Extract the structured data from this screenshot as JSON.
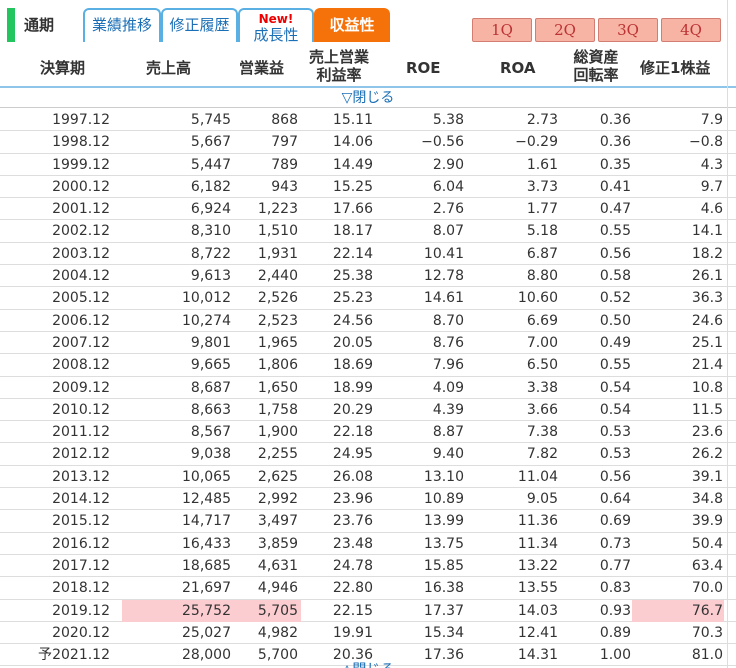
{
  "tabs": {
    "tsuki": "通期",
    "gyoseki": "業績推移",
    "shusei": "修正履歴",
    "seichou_badge": "New!",
    "seichou": "成長性",
    "shueki": "収益性"
  },
  "quarters": [
    "1Q",
    "2Q",
    "3Q",
    "4Q"
  ],
  "headers": {
    "period": "決算期",
    "sales": "売上高",
    "op": "営業益",
    "margin_l1": "売上営業",
    "margin_l2": "利益率",
    "roe": "ROE",
    "roa": "ROA",
    "turnover_l1": "総資産",
    "turnover_l2": "回転率",
    "eps": "修正1株益"
  },
  "toggle": {
    "close_top": "▽閉じる",
    "close_bottom": "△閉じる"
  },
  "colors": {
    "accent": "#f5720a",
    "highlight": "#fbcdd0",
    "tab_border": "#5bb0e3",
    "green_bar": "#22c55e"
  },
  "rows": [
    {
      "year": "1997.12",
      "sales": "5,745",
      "op": "868",
      "margin": "15.11",
      "roe": "5.38",
      "roa": "2.73",
      "turnover": "0.36",
      "eps": "7.9"
    },
    {
      "year": "1998.12",
      "sales": "5,667",
      "op": "797",
      "margin": "14.06",
      "roe": "−0.56",
      "roa": "−0.29",
      "turnover": "0.36",
      "eps": "−0.8"
    },
    {
      "year": "1999.12",
      "sales": "5,447",
      "op": "789",
      "margin": "14.49",
      "roe": "2.90",
      "roa": "1.61",
      "turnover": "0.35",
      "eps": "4.3"
    },
    {
      "year": "2000.12",
      "sales": "6,182",
      "op": "943",
      "margin": "15.25",
      "roe": "6.04",
      "roa": "3.73",
      "turnover": "0.41",
      "eps": "9.7"
    },
    {
      "year": "2001.12",
      "sales": "6,924",
      "op": "1,223",
      "margin": "17.66",
      "roe": "2.76",
      "roa": "1.77",
      "turnover": "0.47",
      "eps": "4.6"
    },
    {
      "year": "2002.12",
      "sales": "8,310",
      "op": "1,510",
      "margin": "18.17",
      "roe": "8.07",
      "roa": "5.18",
      "turnover": "0.55",
      "eps": "14.1"
    },
    {
      "year": "2003.12",
      "sales": "8,722",
      "op": "1,931",
      "margin": "22.14",
      "roe": "10.41",
      "roa": "6.87",
      "turnover": "0.56",
      "eps": "18.2"
    },
    {
      "year": "2004.12",
      "sales": "9,613",
      "op": "2,440",
      "margin": "25.38",
      "roe": "12.78",
      "roa": "8.80",
      "turnover": "0.58",
      "eps": "26.1"
    },
    {
      "year": "2005.12",
      "sales": "10,012",
      "op": "2,526",
      "margin": "25.23",
      "roe": "14.61",
      "roa": "10.60",
      "turnover": "0.52",
      "eps": "36.3"
    },
    {
      "year": "2006.12",
      "sales": "10,274",
      "op": "2,523",
      "margin": "24.56",
      "roe": "8.70",
      "roa": "6.69",
      "turnover": "0.50",
      "eps": "24.6"
    },
    {
      "year": "2007.12",
      "sales": "9,801",
      "op": "1,965",
      "margin": "20.05",
      "roe": "8.76",
      "roa": "7.00",
      "turnover": "0.49",
      "eps": "25.1"
    },
    {
      "year": "2008.12",
      "sales": "9,665",
      "op": "1,806",
      "margin": "18.69",
      "roe": "7.96",
      "roa": "6.50",
      "turnover": "0.55",
      "eps": "21.4"
    },
    {
      "year": "2009.12",
      "sales": "8,687",
      "op": "1,650",
      "margin": "18.99",
      "roe": "4.09",
      "roa": "3.38",
      "turnover": "0.54",
      "eps": "10.8"
    },
    {
      "year": "2010.12",
      "sales": "8,663",
      "op": "1,758",
      "margin": "20.29",
      "roe": "4.39",
      "roa": "3.66",
      "turnover": "0.54",
      "eps": "11.5"
    },
    {
      "year": "2011.12",
      "sales": "8,567",
      "op": "1,900",
      "margin": "22.18",
      "roe": "8.87",
      "roa": "7.38",
      "turnover": "0.53",
      "eps": "23.6"
    },
    {
      "year": "2012.12",
      "sales": "9,038",
      "op": "2,255",
      "margin": "24.95",
      "roe": "9.40",
      "roa": "7.82",
      "turnover": "0.53",
      "eps": "26.2"
    },
    {
      "year": "2013.12",
      "sales": "10,065",
      "op": "2,625",
      "margin": "26.08",
      "roe": "13.10",
      "roa": "11.04",
      "turnover": "0.56",
      "eps": "39.1"
    },
    {
      "year": "2014.12",
      "sales": "12,485",
      "op": "2,992",
      "margin": "23.96",
      "roe": "10.89",
      "roa": "9.05",
      "turnover": "0.64",
      "eps": "34.8"
    },
    {
      "year": "2015.12",
      "sales": "14,717",
      "op": "3,497",
      "margin": "23.76",
      "roe": "13.99",
      "roa": "11.36",
      "turnover": "0.69",
      "eps": "39.9"
    },
    {
      "year": "2016.12",
      "sales": "16,433",
      "op": "3,859",
      "margin": "23.48",
      "roe": "13.75",
      "roa": "11.34",
      "turnover": "0.73",
      "eps": "50.4"
    },
    {
      "year": "2017.12",
      "sales": "18,685",
      "op": "4,631",
      "margin": "24.78",
      "roe": "15.85",
      "roa": "13.22",
      "turnover": "0.77",
      "eps": "63.4"
    },
    {
      "year": "2018.12",
      "sales": "21,697",
      "op": "4,946",
      "margin": "22.80",
      "roe": "16.38",
      "roa": "13.55",
      "turnover": "0.83",
      "eps": "70.0"
    },
    {
      "year": "2019.12",
      "sales": "25,752",
      "op": "5,705",
      "margin": "22.15",
      "roe": "17.37",
      "roa": "14.03",
      "turnover": "0.93",
      "eps": "76.7",
      "hl": [
        "sales",
        "op",
        "eps"
      ]
    },
    {
      "year": "2020.12",
      "sales": "25,027",
      "op": "4,982",
      "margin": "19.91",
      "roe": "15.34",
      "roa": "12.41",
      "turnover": "0.89",
      "eps": "70.3"
    },
    {
      "year": "2021.12",
      "yoso": "予",
      "sales": "28,000",
      "op": "5,700",
      "margin": "20.36",
      "roe": "17.36",
      "roa": "14.31",
      "turnover": "1.00",
      "eps": "81.0"
    }
  ]
}
